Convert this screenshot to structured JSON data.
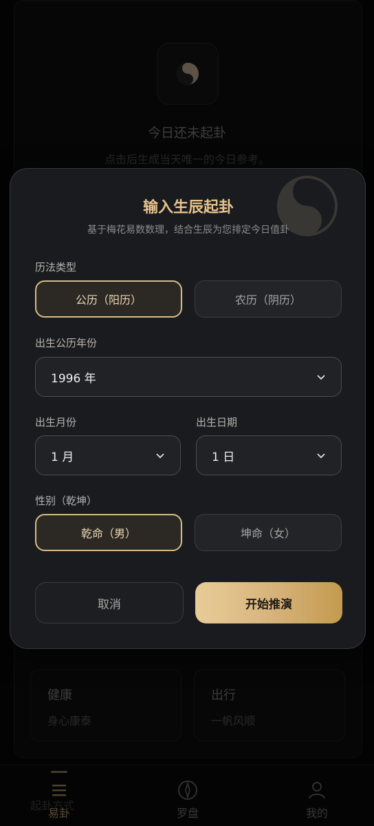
{
  "background": {
    "title": "今日还未起卦",
    "subtitle": "点击后生成当天唯一的今日参考。",
    "tiles": [
      {
        "title": "健康",
        "desc": "身心康泰"
      },
      {
        "title": "出行",
        "desc": "一帆风顺"
      }
    ],
    "peek_text": "起卦方式"
  },
  "modal": {
    "title": "输入生辰起卦",
    "subtitle": "基于梅花易数数理，结合生辰为您排定今日值卦",
    "calendar": {
      "label": "历法类型",
      "options": [
        "公历（阳历）",
        "农历（阴历）"
      ],
      "selected_index": 0
    },
    "year": {
      "label": "出生公历年份",
      "value": "1996 年"
    },
    "month": {
      "label": "出生月份",
      "value": "1 月"
    },
    "day": {
      "label": "出生日期",
      "value": "1 日"
    },
    "gender": {
      "label": "性别（乾坤）",
      "options": [
        "乾命（男）",
        "坤命（女）"
      ],
      "selected_index": 0
    },
    "cancel_label": "取消",
    "submit_label": "开始推演"
  },
  "nav": {
    "items": [
      {
        "label": "易卦",
        "icon": "menu-icon"
      },
      {
        "label": "罗盘",
        "icon": "compass-icon"
      },
      {
        "label": "我的",
        "icon": "user-icon"
      }
    ],
    "active_index": 0
  },
  "colors": {
    "accent_gold": "#d8bc87",
    "modal_bg": "#1a1b1f",
    "page_bg": "#060606"
  }
}
